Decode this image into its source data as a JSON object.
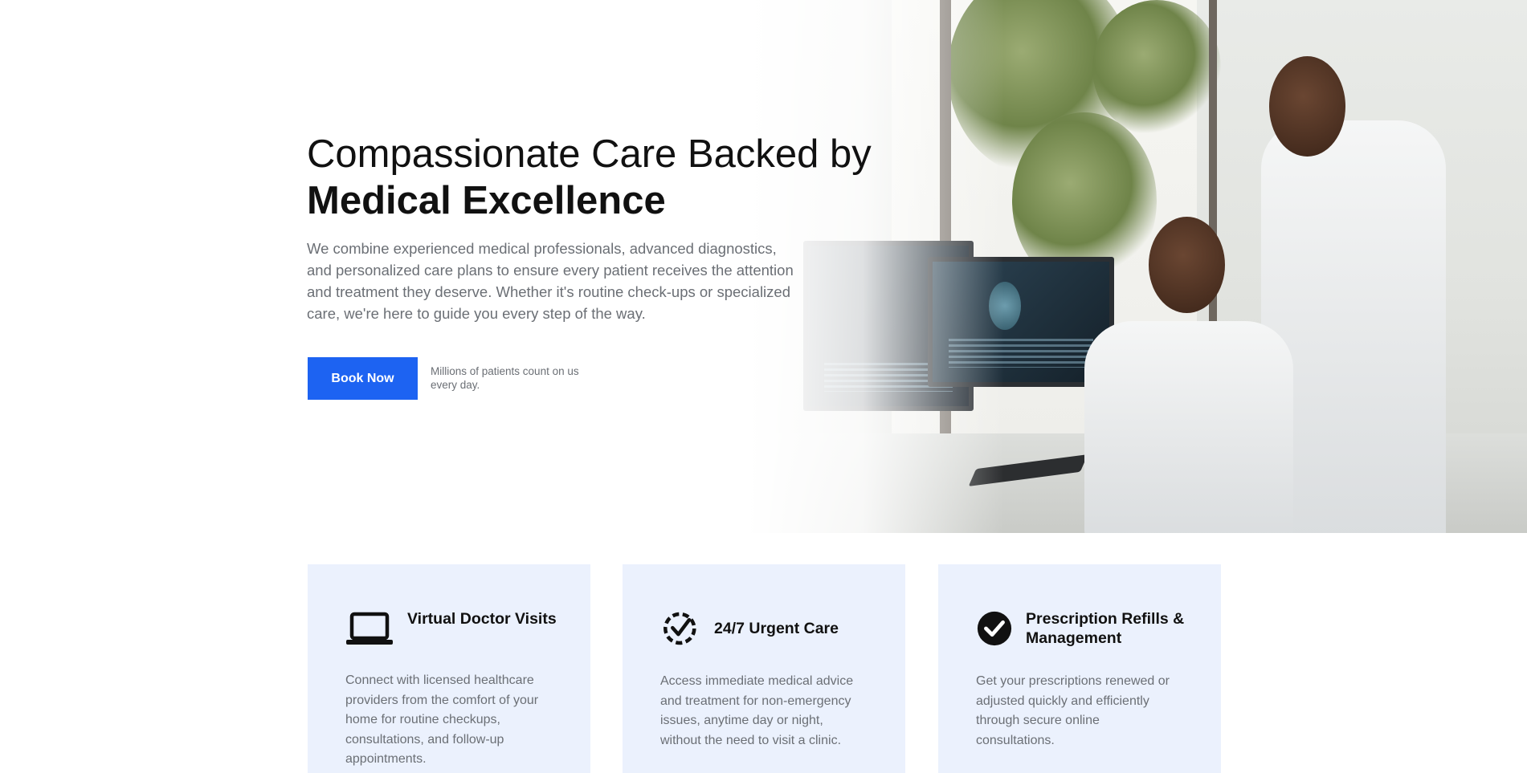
{
  "hero": {
    "title_line1": "Compassionate Care Backed by",
    "title_line2": "Medical Excellence",
    "description": "We combine experienced medical professionals, advanced diagnostics, and personalized care plans to ensure every patient receives the attention and treatment they deserve. Whether it's routine check-ups or specialized care, we're here to guide you every step of the way.",
    "cta_label": "Book Now",
    "cta_note": "Millions of patients count on us every day.",
    "accent_color": "#1d63f2"
  },
  "features": [
    {
      "icon": "laptop-icon",
      "title": "Virtual Doctor Visits",
      "text": "Connect with licensed healthcare providers from the comfort of your home for routine checkups, consultations, and follow-up appointments."
    },
    {
      "icon": "clock-check-icon",
      "title": "24/7 Urgent Care",
      "text": "Access immediate medical advice and treatment for non-emergency issues, anytime day or night, without the need to visit a clinic."
    },
    {
      "icon": "check-circle-icon",
      "title": "Prescription Refills & Management",
      "text": "Get your prescriptions renewed or adjusted quickly and efficiently through secure online consultations."
    }
  ],
  "colors": {
    "card_background": "#ebf1fd",
    "muted_text": "#6b6f75"
  }
}
